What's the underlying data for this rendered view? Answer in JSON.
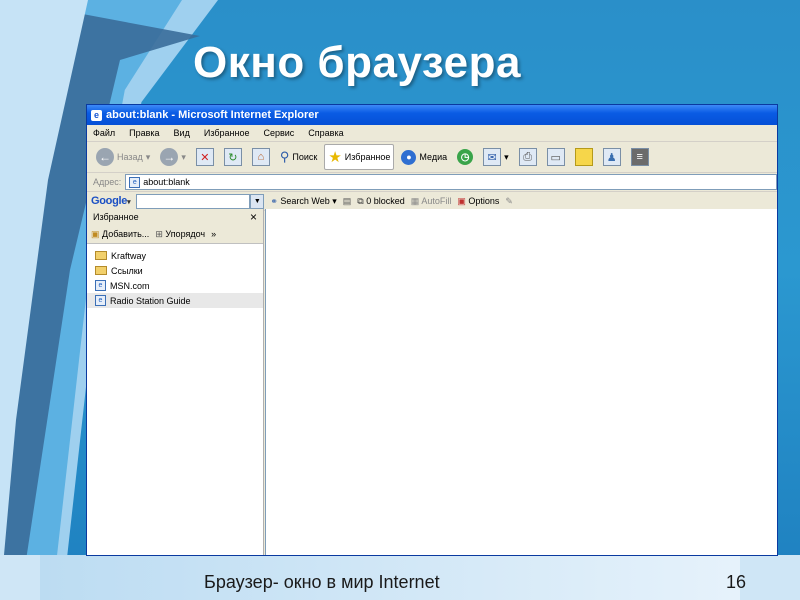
{
  "slide": {
    "title": "Окно браузера",
    "footer": "Браузер- окно в мир Internet",
    "page_number": "16"
  },
  "window": {
    "title": "about:blank - Microsoft Internet Explorer",
    "menu": [
      "Файл",
      "Правка",
      "Вид",
      "Избранное",
      "Сервис",
      "Справка"
    ],
    "toolbar": {
      "back": "Назад",
      "search": "Поиск",
      "favorites": "Избранное",
      "media": "Медиа"
    },
    "address": {
      "label": "Адрес:",
      "value": "about:blank"
    },
    "google": {
      "logo": "Google",
      "search_web": "Search Web",
      "blocked": "0 blocked",
      "autofill": "AutoFill",
      "options": "Options"
    },
    "favorites_pane": {
      "title": "Избранное",
      "close": "×",
      "add": "Добавить...",
      "organize": "Упорядоч",
      "more": "»",
      "items": [
        {
          "label": "Kraftway",
          "type": "folder"
        },
        {
          "label": "Ссылки",
          "type": "folder"
        },
        {
          "label": "MSN.com",
          "type": "page"
        },
        {
          "label": "Radio Station Guide",
          "type": "page"
        }
      ]
    }
  },
  "colors": {
    "slide_bg": "#2b98d0",
    "titlebar": "#0a5ce4",
    "window_chrome": "#ece9d8"
  }
}
